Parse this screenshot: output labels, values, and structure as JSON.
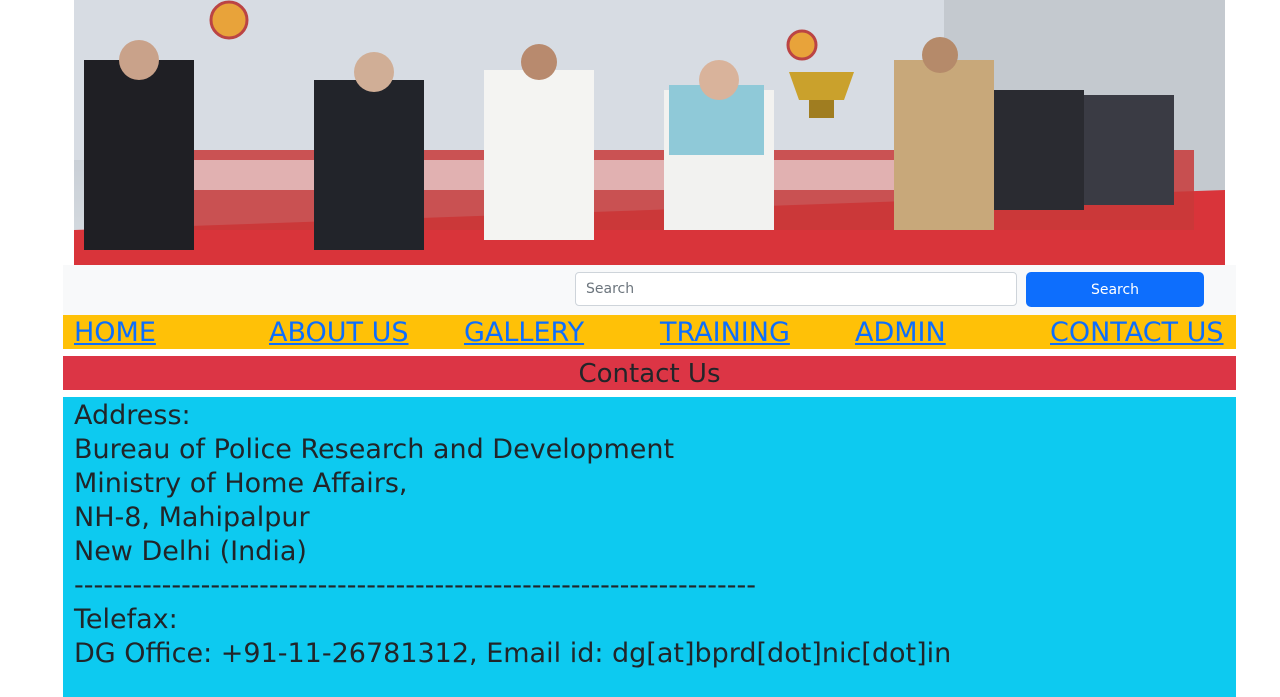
{
  "search": {
    "placeholder": "Search",
    "button_label": "Search"
  },
  "nav": {
    "items": [
      {
        "label": "HOME"
      },
      {
        "label": "ABOUT US"
      },
      {
        "label": "GALLERY"
      },
      {
        "label": "TRAINING"
      },
      {
        "label": "ADMIN"
      },
      {
        "label": "CONTACT US"
      }
    ]
  },
  "page_title": "Contact Us",
  "contact": {
    "address_label": "Address:",
    "address_lines": [
      "Bureau of Police Research and Development",
      "Ministry of Home Affairs,",
      "NH-8, Mahipalpur",
      "New Delhi (India)"
    ],
    "separator": "----------------------------------------------------------------------",
    "telefax_label": "Telefax:",
    "dg_office": "DG Office: +91-11-26781312, Email id: dg[at]bprd[dot]nic[dot]in"
  },
  "colors": {
    "nav_bg": "#ffc107",
    "title_bg": "#dc3545",
    "content_bg": "#0dcaf0",
    "link": "#0d6efd",
    "search_button": "#0d6efd"
  }
}
